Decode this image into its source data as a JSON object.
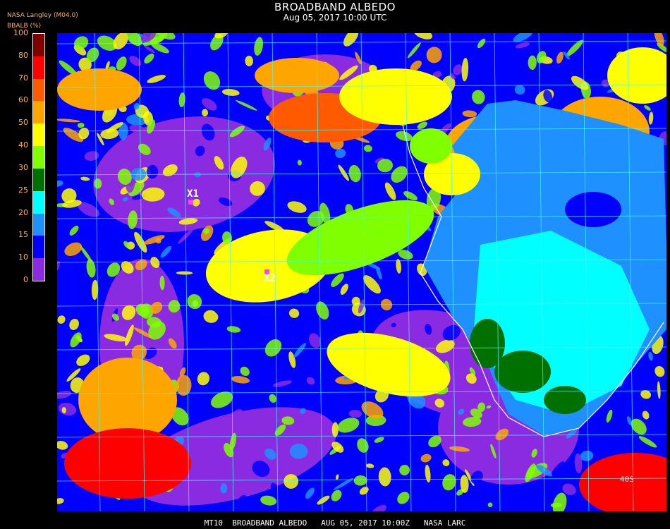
{
  "header": {
    "title": "BROADBAND ALBEDO",
    "subtitle": "Aug 05, 2017 10:00 UTC",
    "source": "NASA Langley (M04.0)",
    "units": "BBALB (%)"
  },
  "colorbar": {
    "ticks": [
      "100",
      "80",
      "70",
      "60",
      "50",
      "40",
      "30",
      "25",
      "20",
      "15",
      "10",
      "0"
    ],
    "bins": [
      {
        "min": 80,
        "max": 100,
        "color": "#800000"
      },
      {
        "min": 70,
        "max": 80,
        "color": "#ff0000"
      },
      {
        "min": 60,
        "max": 70,
        "color": "#ff5a00"
      },
      {
        "min": 50,
        "max": 60,
        "color": "#ffa500"
      },
      {
        "min": 40,
        "max": 50,
        "color": "#ffff00"
      },
      {
        "min": 30,
        "max": 40,
        "color": "#80ff00"
      },
      {
        "min": 25,
        "max": 30,
        "color": "#007000"
      },
      {
        "min": 20,
        "max": 25,
        "color": "#00ffff"
      },
      {
        "min": 15,
        "max": 20,
        "color": "#1e90ff"
      },
      {
        "min": 10,
        "max": 15,
        "color": "#0000ff"
      },
      {
        "min": 0,
        "max": 10,
        "color": "#8a2be2"
      }
    ]
  },
  "map": {
    "grid_color": "#40ffff",
    "coast_color": "#ffffff",
    "sites": [
      {
        "label": "X1"
      },
      {
        "label": "X2"
      }
    ],
    "grid_labels": [
      "40S"
    ]
  },
  "footer": {
    "text": "MT10  BROADBAND ALBEDO   AUG 05, 2017 10:00Z   NASA LARC"
  }
}
